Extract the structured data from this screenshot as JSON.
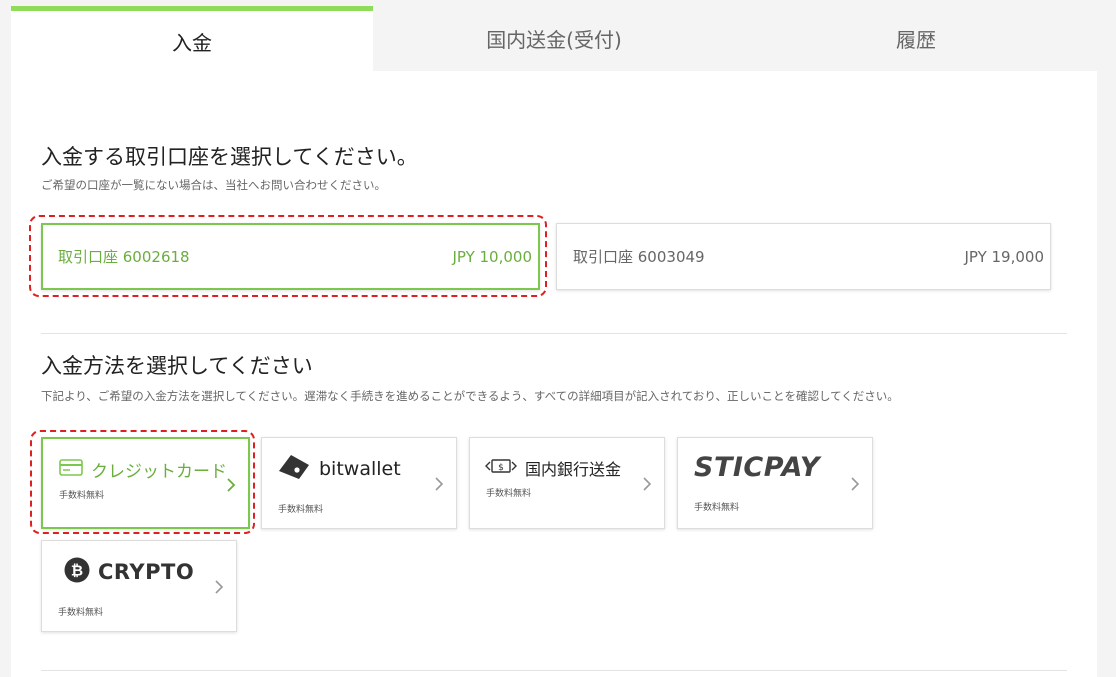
{
  "tabs": [
    {
      "label": "入金",
      "active": true
    },
    {
      "label": "国内送金(受付)",
      "active": false
    },
    {
      "label": "履歴",
      "active": false
    }
  ],
  "account_section": {
    "title": "入金する取引口座を選択してください。",
    "subtitle": "ご希望の口座が一覧にない場合は、当社へお問い合わせください。",
    "accounts": [
      {
        "name": "取引口座 6002618",
        "balance": "JPY 10,000",
        "selected": true
      },
      {
        "name": "取引口座 6003049",
        "balance": "JPY 19,000",
        "selected": false
      }
    ]
  },
  "method_section": {
    "title": "入金方法を選択してください",
    "subtitle": "下記より、ご希望の入金方法を選択してください。遅滞なく手続きを進めることができるよう、すべての詳細項目が記入されており、正しいことを確認してください。",
    "methods": [
      {
        "label": "クレジットカード",
        "fee": "手数料無料",
        "icon": "credit-card-icon",
        "selected": true
      },
      {
        "label": "bitwallet",
        "fee": "手数料無料",
        "icon": "bitwallet-logo-icon",
        "selected": false
      },
      {
        "label": "国内銀行送金",
        "fee": "手数料無料",
        "icon": "bank-transfer-icon",
        "selected": false
      },
      {
        "label": "STICPAY",
        "fee": "手数料無料",
        "icon": "sticpay-logo",
        "selected": false
      },
      {
        "label": "CRYPTO",
        "fee": "手数料無料",
        "icon": "bitcoin-icon",
        "selected": false
      }
    ]
  },
  "colors": {
    "accent": "#7cc84e",
    "highlight": "#e02020"
  }
}
